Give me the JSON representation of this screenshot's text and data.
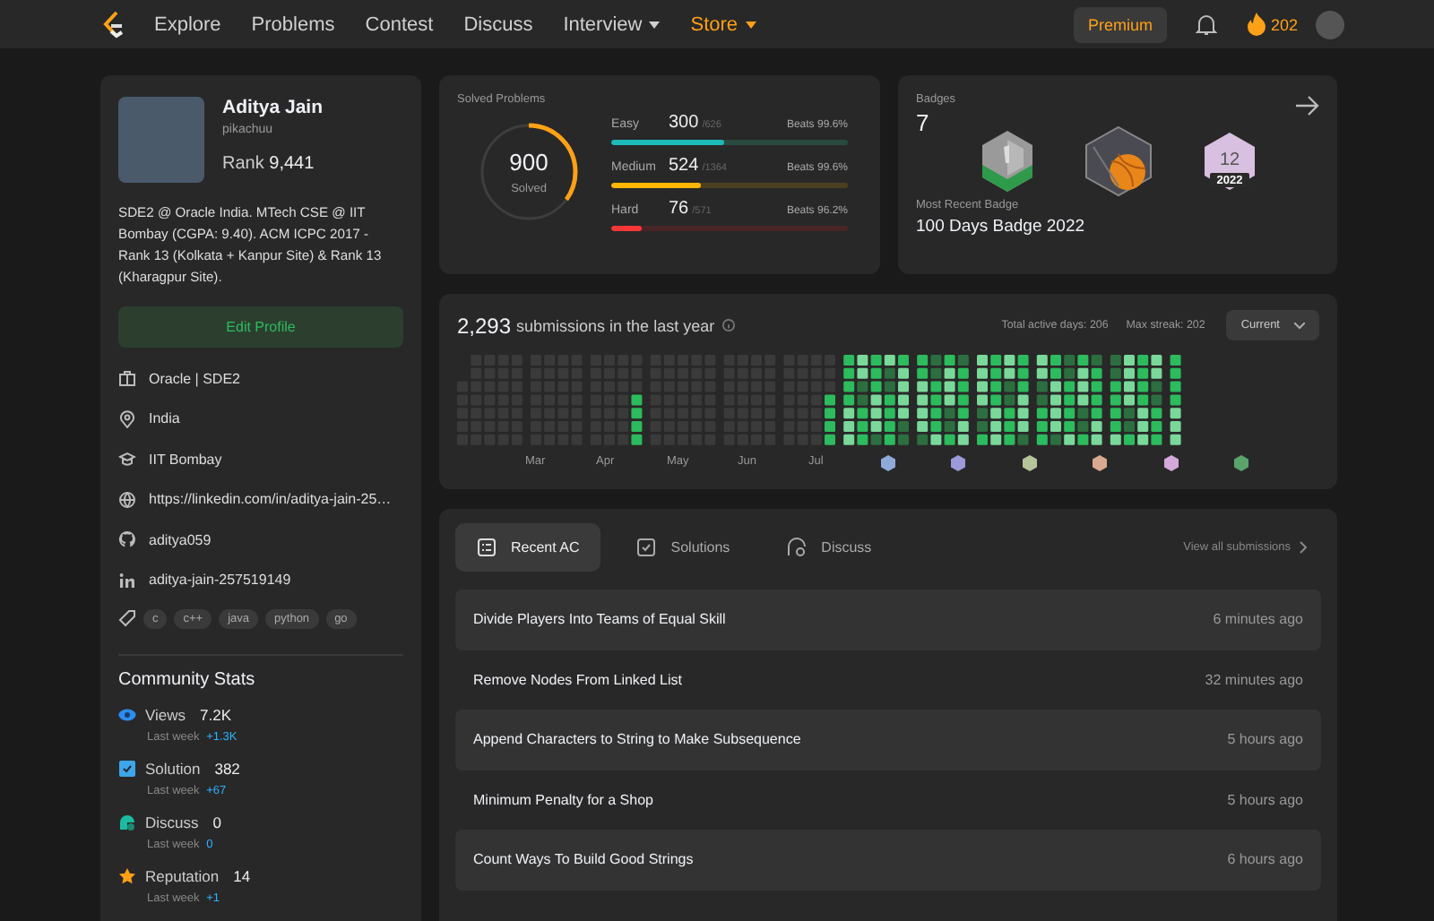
{
  "nav": {
    "items": [
      {
        "label": "Explore",
        "has_menu": false,
        "highlighted": false
      },
      {
        "label": "Problems",
        "has_menu": false,
        "highlighted": false
      },
      {
        "label": "Contest",
        "has_menu": false,
        "highlighted": false
      },
      {
        "label": "Discuss",
        "has_menu": false,
        "highlighted": false
      },
      {
        "label": "Interview",
        "has_menu": true,
        "highlighted": false
      },
      {
        "label": "Store",
        "has_menu": true,
        "highlighted": true
      }
    ],
    "premium": "Premium",
    "streak": "202"
  },
  "profile": {
    "name": "Aditya Jain",
    "username": "pikachuu",
    "rank_label": "Rank",
    "rank": "9,441",
    "bio": "SDE2 @ Oracle India. MTech CSE @ IIT Bombay (CGPA: 9.40). ACM ICPC 2017 - Rank 13 (Kolkata + Kanpur Site) & Rank 13 (Kharagpur Site).",
    "edit_button": "Edit Profile",
    "details": [
      {
        "kind": "work",
        "text": "Oracle | SDE2"
      },
      {
        "kind": "location",
        "text": "India"
      },
      {
        "kind": "school",
        "text": "IIT Bombay"
      },
      {
        "kind": "website",
        "text": "https://linkedin.com/in/aditya-jain-25…"
      },
      {
        "kind": "github",
        "text": "aditya059"
      },
      {
        "kind": "linkedin",
        "text": "aditya-jain-257519149"
      }
    ],
    "skills": [
      "c",
      "c++",
      "java",
      "python",
      "go"
    ]
  },
  "community_stats": {
    "title": "Community Stats",
    "items": [
      {
        "kind": "views",
        "label": "Views",
        "value": "7.2K",
        "sub_label": "Last week",
        "change": "+1.3K"
      },
      {
        "kind": "solution",
        "label": "Solution",
        "value": "382",
        "sub_label": "Last week",
        "change": "+67"
      },
      {
        "kind": "discuss",
        "label": "Discuss",
        "value": "0",
        "sub_label": "Last week",
        "change": "0"
      },
      {
        "kind": "reputation",
        "label": "Reputation",
        "value": "14",
        "sub_label": "Last week",
        "change": "+1"
      }
    ]
  },
  "solved": {
    "title": "Solved Problems",
    "total": "900",
    "total_label": "Solved",
    "level": 0.35,
    "difficulties": [
      {
        "kind": "easy",
        "label": "Easy",
        "solved": "300",
        "total": "/626",
        "beats": "Beats",
        "beats_value": "99.6%",
        "level": 0.48
      },
      {
        "kind": "medium",
        "label": "Medium",
        "solved": "524",
        "total": "/1364",
        "beats": "Beats",
        "beats_value": "99.6%",
        "level": 0.38
      },
      {
        "kind": "hard",
        "label": "Hard",
        "solved": "76",
        "total": "/571",
        "beats": "Beats",
        "beats_value": "96.2%",
        "level": 0.13
      }
    ]
  },
  "badges": {
    "title": "Badges",
    "count": "7",
    "items": [
      {
        "kind": "annual"
      },
      {
        "kind": "contest"
      },
      {
        "kind": "monthly",
        "label": "12",
        "year": "2022"
      }
    ],
    "recent_label": "Most Recent Badge",
    "recent": "100 Days Badge 2022"
  },
  "submissions": {
    "count": "2,293",
    "label": "submissions in the last year",
    "active_days": "Total active days: 206",
    "max_streak": "Max streak: 202",
    "period": "Current",
    "months": [
      {
        "label": "Mar"
      },
      {
        "label": "Apr"
      },
      {
        "label": "May"
      },
      {
        "label": "Jun"
      },
      {
        "label": "Jul"
      },
      {
        "kind": "badge",
        "color": "#8fa9d9"
      },
      {
        "kind": "badge",
        "color": "#9d9ad9"
      },
      {
        "kind": "badge",
        "color": "#b5c49a"
      },
      {
        "kind": "badge",
        "color": "#d9a98f"
      },
      {
        "kind": "badge",
        "color": "#d3a9d9"
      },
      {
        "kind": "badge",
        "color": "#5aa36a"
      }
    ]
  },
  "recent": {
    "tabs": [
      {
        "label": "Recent AC",
        "kind": "list",
        "selected": true
      },
      {
        "label": "Solutions",
        "kind": "check",
        "selected": false
      },
      {
        "label": "Discuss",
        "kind": "discuss",
        "selected": false
      }
    ],
    "view_all": "View all submissions",
    "rows": [
      {
        "title": "Divide Players Into Teams of Equal Skill",
        "time": "6 minutes ago"
      },
      {
        "title": "Remove Nodes From Linked List",
        "time": "32 minutes ago"
      },
      {
        "title": "Append Characters to String to Make Subsequence",
        "time": "5 hours ago"
      },
      {
        "title": "Minimum Penalty for a Shop",
        "time": "5 hours ago"
      },
      {
        "title": "Count Ways To Build Good Strings",
        "time": "6 hours ago"
      }
    ]
  }
}
